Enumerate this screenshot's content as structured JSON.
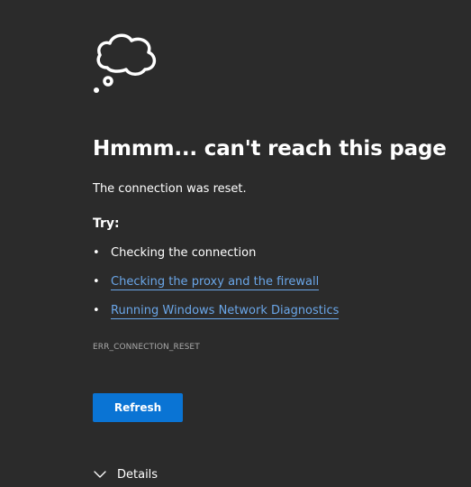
{
  "error_page": {
    "title": "Hmmm... can't reach this page",
    "message": "The connection was reset.",
    "try_label": "Try:",
    "suggestions": [
      {
        "text": "Checking the connection",
        "is_link": false
      },
      {
        "text": "Checking the proxy and the firewall",
        "is_link": true
      },
      {
        "text": "Running Windows Network Diagnostics",
        "is_link": true
      }
    ],
    "bullet": "•",
    "error_code": "ERR_CONNECTION_RESET",
    "refresh_label": "Refresh",
    "details_label": "Details",
    "icon": "thought-cloud-icon"
  },
  "colors": {
    "background": "#2b2b2b",
    "text": "#ffffff",
    "link": "#6aa6e8",
    "button": "#0a74d4",
    "error_code": "#a8a8a8"
  }
}
